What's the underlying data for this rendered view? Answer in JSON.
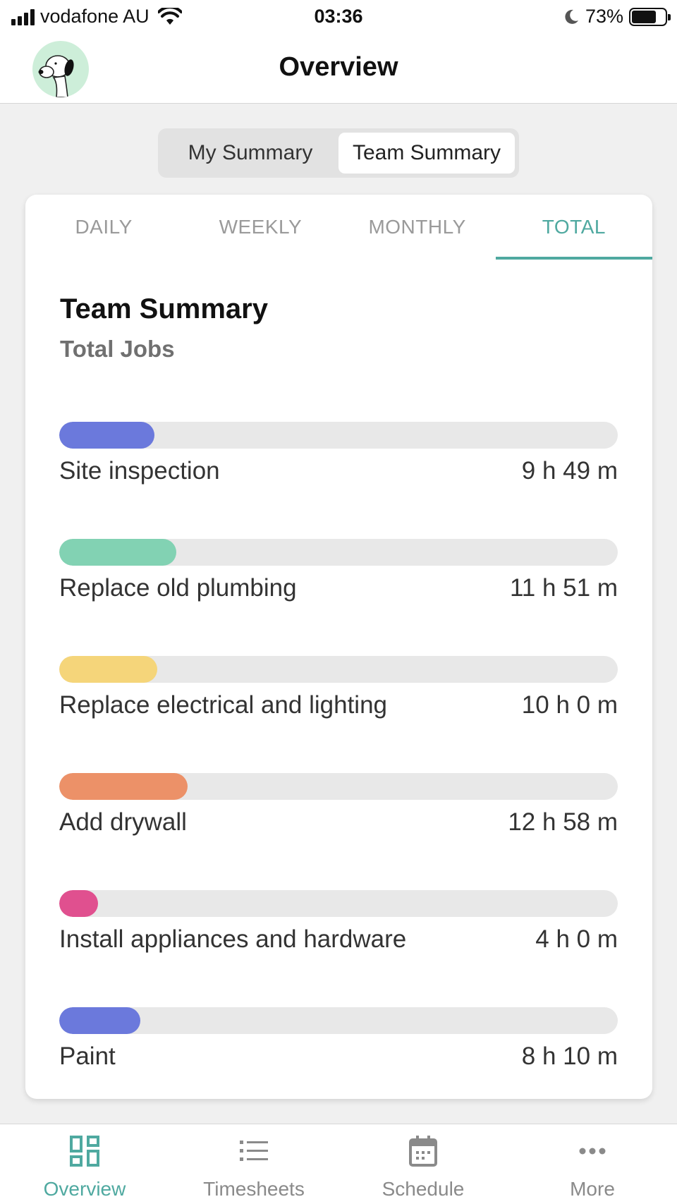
{
  "status_bar": {
    "carrier": "vodafone AU",
    "time": "03:36",
    "battery": "73%",
    "battery_level": 0.73
  },
  "header": {
    "title": "Overview",
    "avatar_icon": "snoopy-avatar-icon"
  },
  "segments": {
    "items": [
      "My Summary",
      "Team Summary"
    ],
    "active": "Team Summary"
  },
  "period_tabs": {
    "items": [
      "DAILY",
      "WEEKLY",
      "MONTHLY",
      "TOTAL"
    ],
    "active": "TOTAL",
    "accent": "#4fa9a0"
  },
  "card": {
    "title": "Team Summary",
    "subtitle": "Total Jobs"
  },
  "jobs": [
    {
      "name": "Site inspection",
      "time": "9 h 49 m",
      "fraction": 0.17,
      "color": "#6b79dc"
    },
    {
      "name": "Replace old plumbing",
      "time": "11 h 51 m",
      "fraction": 0.21,
      "color": "#82d2b3"
    },
    {
      "name": "Replace electrical and lighting",
      "time": "10 h 0 m",
      "fraction": 0.175,
      "color": "#f5d57a"
    },
    {
      "name": "Add drywall",
      "time": "12 h 58 m",
      "fraction": 0.23,
      "color": "#ec9168"
    },
    {
      "name": "Install appliances and hardware",
      "time": "4 h 0 m",
      "fraction": 0.07,
      "color": "#e0508f"
    },
    {
      "name": "Paint",
      "time": "8 h 10 m",
      "fraction": 0.145,
      "color": "#6b79dc"
    }
  ],
  "bottom_nav": {
    "items": [
      {
        "label": "Overview",
        "icon": "dashboard-icon"
      },
      {
        "label": "Timesheets",
        "icon": "list-icon"
      },
      {
        "label": "Schedule",
        "icon": "calendar-icon"
      },
      {
        "label": "More",
        "icon": "more-dots-icon"
      }
    ],
    "active": "Overview"
  }
}
